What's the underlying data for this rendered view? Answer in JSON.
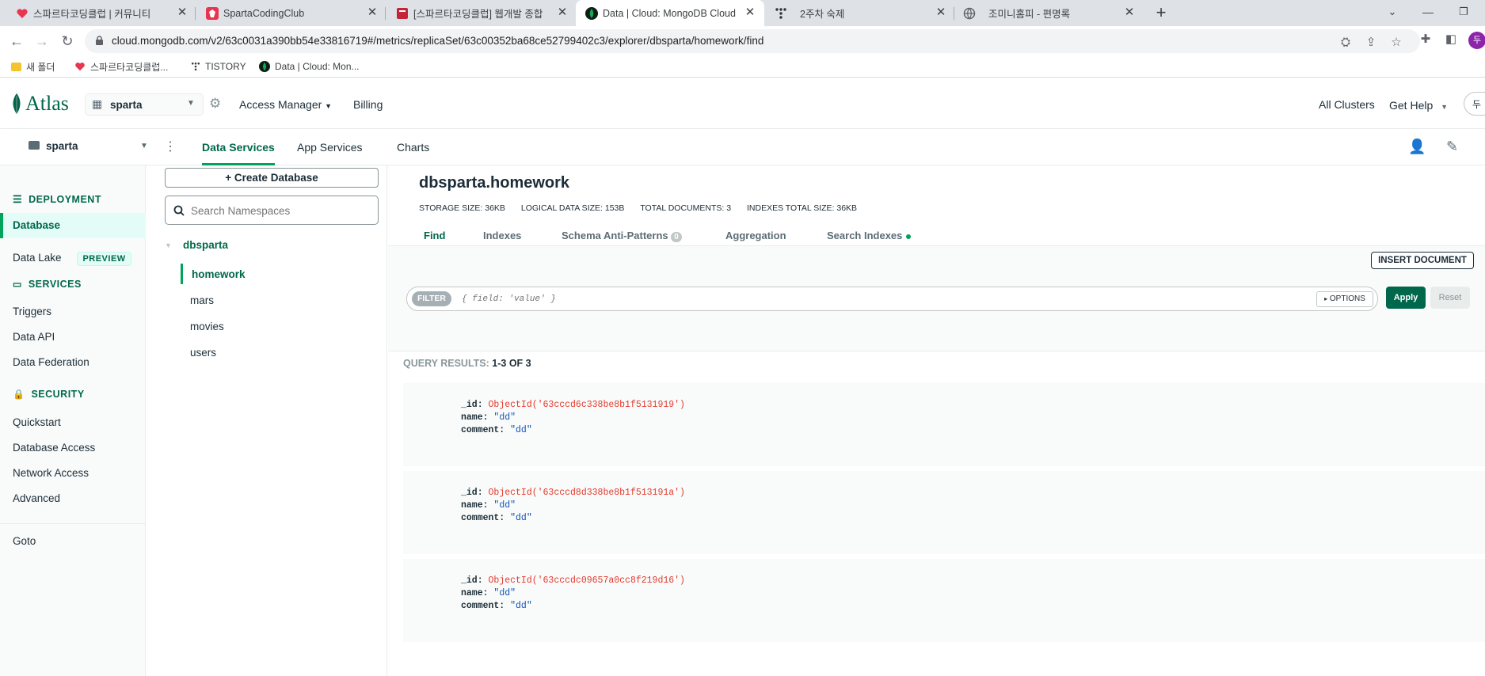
{
  "browser": {
    "tabs": [
      {
        "title": "스파르타코딩클럽 | 커뮤니티",
        "active": false
      },
      {
        "title": "SpartaCodingClub",
        "active": false
      },
      {
        "title": "[스파르타코딩클럽] 웹개발 종합",
        "active": false
      },
      {
        "title": "Data | Cloud: MongoDB Cloud",
        "active": true
      },
      {
        "title": "2주차 숙제",
        "active": false
      },
      {
        "title": "조미니홈피 - 편명록",
        "active": false
      }
    ],
    "url": "cloud.mongodb.com/v2/63c0031a390bb54e33816719#/metrics/replicaSet/63c00352ba68ce52799402c3/explorer/dbsparta/homework/find",
    "profile_initial": "두",
    "bookmarks": [
      "새 폴더",
      "스파르타코딩클럽...",
      "TISTORY",
      "Data | Cloud: Mon..."
    ]
  },
  "atlas": {
    "logo": "Atlas",
    "org": "sparta",
    "access_manager": "Access Manager",
    "billing": "Billing",
    "all_clusters": "All Clusters",
    "get_help": "Get Help",
    "project": "sparta",
    "sub_tabs": [
      "Data Services",
      "App Services",
      "Charts"
    ]
  },
  "leftnav": {
    "deployment": "DEPLOYMENT",
    "database": "Database",
    "data_lake": "Data Lake",
    "preview": "PREVIEW",
    "services": "SERVICES",
    "triggers": "Triggers",
    "data_api": "Data API",
    "data_federation": "Data Federation",
    "security": "SECURITY",
    "quickstart": "Quickstart",
    "database_access": "Database Access",
    "network_access": "Network Access",
    "advanced": "Advanced",
    "goto": "Goto"
  },
  "namespaces": {
    "create_db": "Create Database",
    "search_placeholder": "Search Namespaces",
    "db": "dbsparta",
    "collections": [
      "homework",
      "mars",
      "movies",
      "users"
    ]
  },
  "collection": {
    "title": "dbsparta.homework",
    "stats": {
      "storage": "STORAGE SIZE: 36KB",
      "logical": "LOGICAL DATA SIZE: 153B",
      "total_docs": "TOTAL DOCUMENTS: 3",
      "indexes_size": "INDEXES TOTAL SIZE: 36KB"
    },
    "tabs": {
      "find": "Find",
      "indexes": "Indexes",
      "schema": "Schema Anti-Patterns",
      "schema_badge": "0",
      "aggregation": "Aggregation",
      "search_indexes": "Search Indexes"
    },
    "insert_document": "INSERT DOCUMENT",
    "filter_label": "FILTER",
    "filter_placeholder": "{ field: 'value' }",
    "options": "OPTIONS",
    "apply": "Apply",
    "reset": "Reset",
    "query_results_label": "QUERY RESULTS:",
    "query_results_count": "1-3 OF 3",
    "documents": [
      {
        "id": "ObjectId('63cccd6c338be8b1f5131919')",
        "name": "\"dd\"",
        "comment": "\"dd\""
      },
      {
        "id": "ObjectId('63cccd8d338be8b1f513191a')",
        "name": "\"dd\"",
        "comment": "\"dd\""
      },
      {
        "id": "ObjectId('63cccdc09657a0cc8f219d16')",
        "name": "\"dd\"",
        "comment": "\"dd\""
      }
    ],
    "field_labels": {
      "id": "_id:",
      "name": "name:",
      "comment": "comment:"
    }
  },
  "colors": {
    "brand_green": "#00684a",
    "accent_green": "#00a35c"
  }
}
